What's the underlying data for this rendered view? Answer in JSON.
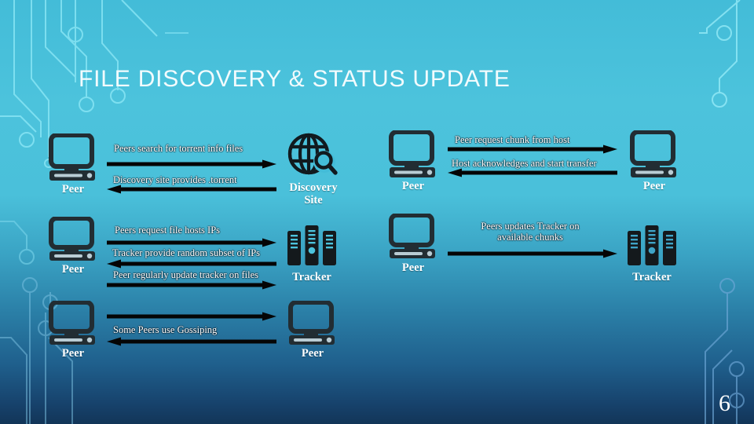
{
  "slide": {
    "title": "FILE DISCOVERY & STATUS UPDATE",
    "page_number": "6",
    "colors": {
      "background_top": "#43bcd8",
      "background_bottom": "#123558",
      "icon_dark": "#1f2a30",
      "text_white": "#ffffff",
      "circuit_line": "#8fe4f2"
    }
  },
  "nodes": {
    "peer_r1_left": {
      "label": "Peer",
      "icon": "desktop-computer-icon"
    },
    "discovery_site": {
      "label": "Discovery\nSite",
      "label_line1": "Discovery",
      "label_line2": "Site",
      "icon": "globe-search-icon"
    },
    "peer_r1_mid": {
      "label": "Peer",
      "icon": "desktop-computer-icon"
    },
    "peer_r1_right": {
      "label": "Peer",
      "icon": "desktop-computer-icon"
    },
    "peer_r2_left": {
      "label": "Peer",
      "icon": "desktop-computer-icon"
    },
    "tracker_left": {
      "label": "Tracker",
      "icon": "server-rack-icon"
    },
    "peer_r2_mid": {
      "label": "Peer",
      "icon": "desktop-computer-icon"
    },
    "tracker_right": {
      "label": "Tracker",
      "icon": "server-rack-icon"
    },
    "peer_r3_left": {
      "label": "Peer",
      "icon": "desktop-computer-icon"
    },
    "peer_r3_mid": {
      "label": "Peer",
      "icon": "desktop-computer-icon"
    }
  },
  "flows": {
    "discovery": [
      {
        "label": "Peers search for torrent info files",
        "direction": "right"
      },
      {
        "label": "Discovery site provides .torrent",
        "direction": "left"
      }
    ],
    "chunk_transfer": [
      {
        "label": "Peer request chunk from host",
        "direction": "right"
      },
      {
        "label": "Host acknowledges and start transfer",
        "direction": "left"
      }
    ],
    "tracker_left": [
      {
        "label": "Peers request file hosts IPs",
        "direction": "right"
      },
      {
        "label": "Tracker provide random subset of IPs",
        "direction": "left"
      },
      {
        "label": "Peer regularly update tracker on files",
        "direction": "right"
      }
    ],
    "tracker_right": [
      {
        "label_line1": "Peers updates Tracker on",
        "label_line2": "available chunks",
        "direction": "right"
      }
    ],
    "gossiping": [
      {
        "label": "Some Peers use Gossiping",
        "direction": "both"
      }
    ]
  }
}
